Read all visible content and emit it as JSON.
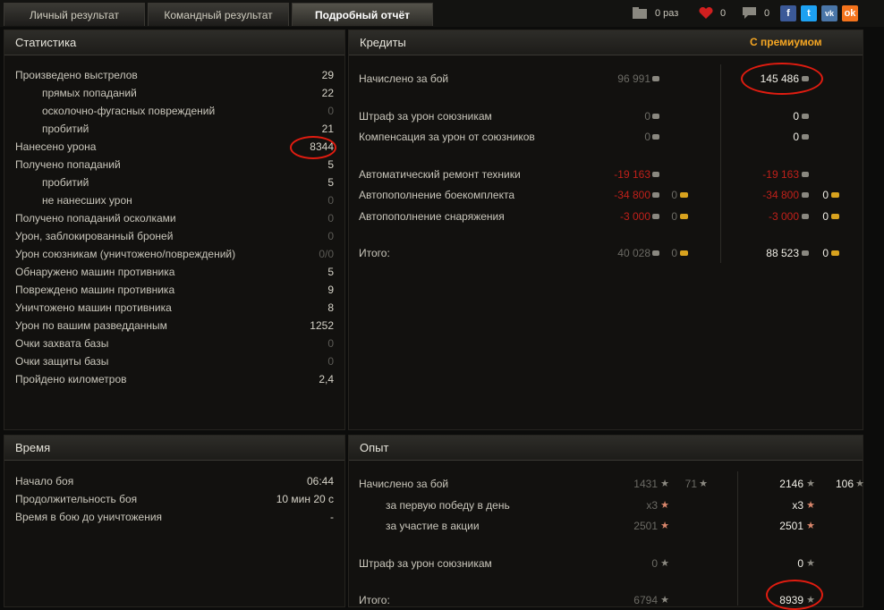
{
  "tabs": [
    "Личный результат",
    "Командный результат",
    "Подробный отчёт"
  ],
  "toolbar": {
    "count_label": "0 раз",
    "likes": "0",
    "comments": "0",
    "social": [
      "f",
      "t",
      "vk",
      "ok"
    ]
  },
  "stats": {
    "title": "Статистика",
    "rows": [
      {
        "label": "Произведено выстрелов",
        "value": "29"
      },
      {
        "label": "прямых попаданий",
        "value": "22"
      },
      {
        "label": "осколочно-фугасных повреждений",
        "value": "0"
      },
      {
        "label": "пробитий",
        "value": "21"
      },
      {
        "label": "Нанесено урона",
        "value": "8344"
      },
      {
        "label": "Получено попаданий",
        "value": "5"
      },
      {
        "label": "пробитий",
        "value": "5"
      },
      {
        "label": "не нанесших урон",
        "value": "0"
      },
      {
        "label": "Получено попаданий осколками",
        "value": "0"
      },
      {
        "label": "Урон, заблокированный броней",
        "value": "0"
      },
      {
        "label": "Урон союзникам (уничтожено/повреждений)",
        "value": "0/0"
      },
      {
        "label": "Обнаружено машин противника",
        "value": "5"
      },
      {
        "label": "Повреждено машин противника",
        "value": "9"
      },
      {
        "label": "Уничтожено машин противника",
        "value": "8"
      },
      {
        "label": "Урон по вашим разведданным",
        "value": "1252"
      },
      {
        "label": "Очки захвата базы",
        "value": "0"
      },
      {
        "label": "Очки защиты базы",
        "value": "0"
      },
      {
        "label": "Пройдено километров",
        "value": "2,4"
      }
    ]
  },
  "credits": {
    "title": "Кредиты",
    "premium_title": "С премиумом",
    "rows": [
      {
        "label": "Начислено за бой",
        "base": "96 991",
        "prem": "145 486"
      },
      {
        "label": "Штраф за урон союзникам",
        "base": "0",
        "prem": "0"
      },
      {
        "label": "Компенсация за урон от союзников",
        "base": "0",
        "prem": "0"
      },
      {
        "label": "Автоматический ремонт техники",
        "base": "-19 163",
        "prem": "-19 163"
      },
      {
        "label": "Автопополнение боекомплекта",
        "base": "-34 800",
        "base_gold": "0",
        "prem": "-34 800",
        "prem_gold": "0"
      },
      {
        "label": "Автопополнение снаряжения",
        "base": "-3 000",
        "base_gold": "0",
        "prem": "-3 000",
        "prem_gold": "0"
      },
      {
        "label": "Итого:",
        "base": "40 028",
        "base_gold": "0",
        "prem": "88 523",
        "prem_gold": "0"
      }
    ]
  },
  "time": {
    "title": "Время",
    "rows": [
      {
        "label": "Начало боя",
        "value": "06:44"
      },
      {
        "label": "Продолжительность боя",
        "value": "10 мин 20 с"
      },
      {
        "label": "Время в бою до уничтожения",
        "value": "-"
      }
    ]
  },
  "exp": {
    "title": "Опыт",
    "rows": [
      {
        "label": "Начислено за бой",
        "base": "1431",
        "base_free": "71",
        "prem": "2146",
        "prem_free": "106"
      },
      {
        "label": "за первую победу в день",
        "base": "x3",
        "prem": "x3"
      },
      {
        "label": "за участие в акции",
        "base": "2501",
        "prem": "2501"
      },
      {
        "label": "Штраф за урон союзникам",
        "base": "0",
        "prem": "0"
      },
      {
        "label": "Итого:",
        "base": "6794",
        "prem": "8939"
      }
    ]
  }
}
